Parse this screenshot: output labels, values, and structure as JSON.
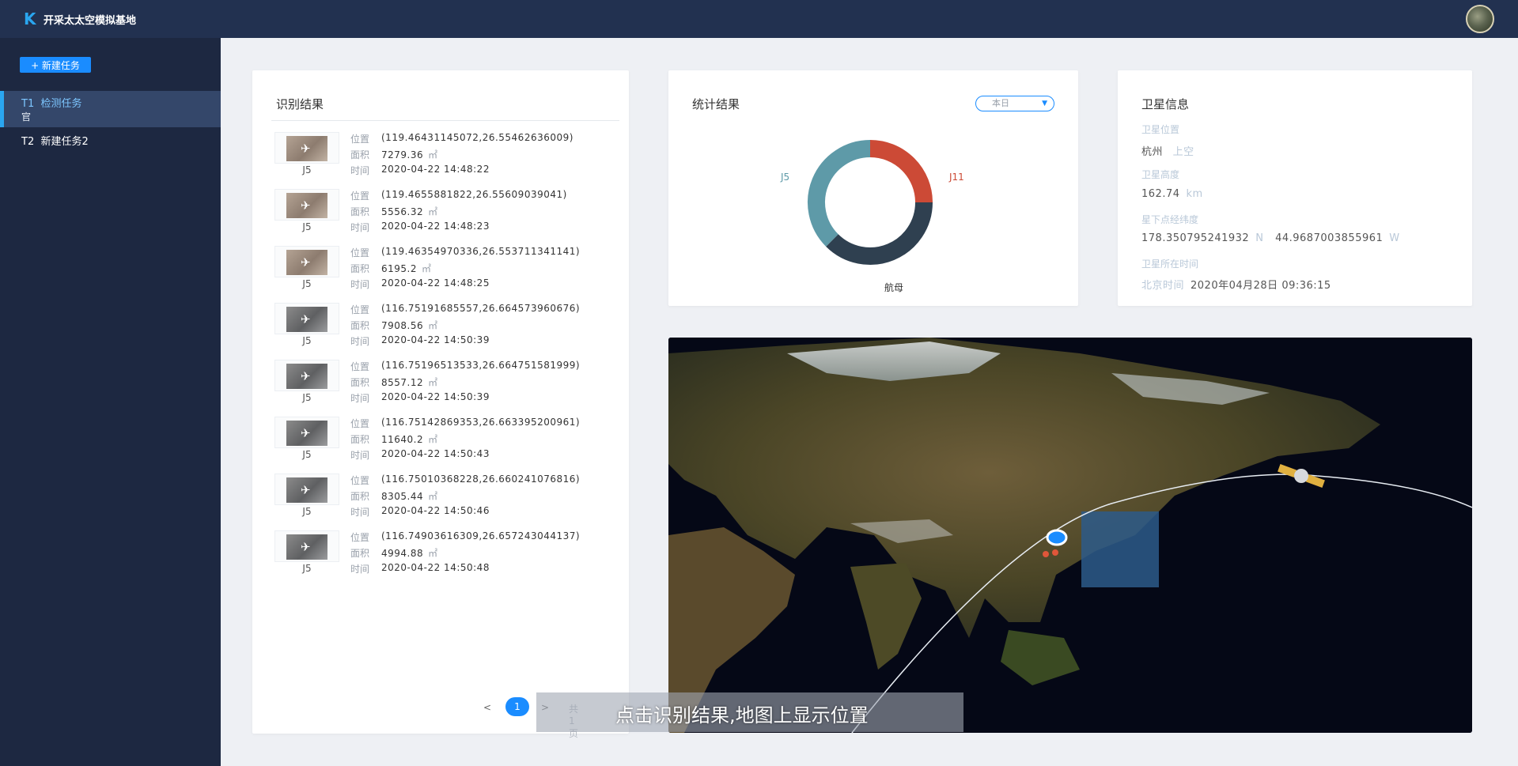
{
  "header": {
    "logo_letter": "K",
    "title": "开采太太空模拟基地"
  },
  "sidebar": {
    "new_task_button": "+ 新建任务",
    "tasks": [
      {
        "id": "T1",
        "label": "检测任务",
        "sub": "官"
      },
      {
        "id": "T2",
        "label": "新建任务2",
        "sub": ""
      }
    ]
  },
  "results": {
    "title": "识别结果",
    "field_labels": {
      "position": "位置",
      "area": "面积",
      "time": "时间"
    },
    "area_unit": "㎡",
    "items": [
      {
        "label": "J5",
        "position": "(119.46431145072,26.55462636009)",
        "area": "7279.36",
        "time": "2020-04-22 14:48:22"
      },
      {
        "label": "J5",
        "position": "(119.4655881822,26.55609039041)",
        "area": "5556.32",
        "time": "2020-04-22 14:48:23"
      },
      {
        "label": "J5",
        "position": "(119.46354970336,26.553711341141)",
        "area": "6195.2",
        "time": "2020-04-22 14:48:25"
      },
      {
        "label": "J5",
        "position": "(116.75191685557,26.664573960676)",
        "area": "7908.56",
        "time": "2020-04-22 14:50:39"
      },
      {
        "label": "J5",
        "position": "(116.75196513533,26.664751581999)",
        "area": "8557.12",
        "time": "2020-04-22 14:50:39"
      },
      {
        "label": "J5",
        "position": "(116.75142869353,26.663395200961)",
        "area": "11640.2",
        "time": "2020-04-22 14:50:43"
      },
      {
        "label": "J5",
        "position": "(116.75010368228,26.660241076816)",
        "area": "8305.44",
        "time": "2020-04-22 14:50:46"
      },
      {
        "label": "J5",
        "position": "(116.74903616309,26.657243044137)",
        "area": "4994.88",
        "time": "2020-04-22 14:50:48"
      }
    ],
    "pagination": {
      "prev": "<",
      "current": "1",
      "next": ">",
      "total": "共 1页"
    }
  },
  "stats": {
    "title": "统计结果",
    "period_select": "本日",
    "chart_data": {
      "type": "pie",
      "categories": [
        "J11",
        "航母",
        "J5"
      ],
      "values": [
        25,
        37.5,
        37.5
      ],
      "colors": [
        "#cc4a36",
        "#2f4050",
        "#5e9aa8"
      ]
    }
  },
  "satellite": {
    "title": "卫星信息",
    "position_label": "卫星位置",
    "position_city": "杭州",
    "position_suffix": "上空",
    "altitude_label": "卫星高度",
    "altitude_value": "162.74",
    "altitude_unit": "km",
    "subpoint_label": "星下点经纬度",
    "subpoint_lat": "178.350795241932",
    "subpoint_lat_unit": "N",
    "subpoint_lon": "44.9687003855961",
    "subpoint_lon_unit": "W",
    "time_label": "卫星所在时间",
    "time_prefix": "北京时间",
    "time_value": "2020年04月28日 09:36:15"
  },
  "caption": "点击识别结果,地图上显示位置"
}
